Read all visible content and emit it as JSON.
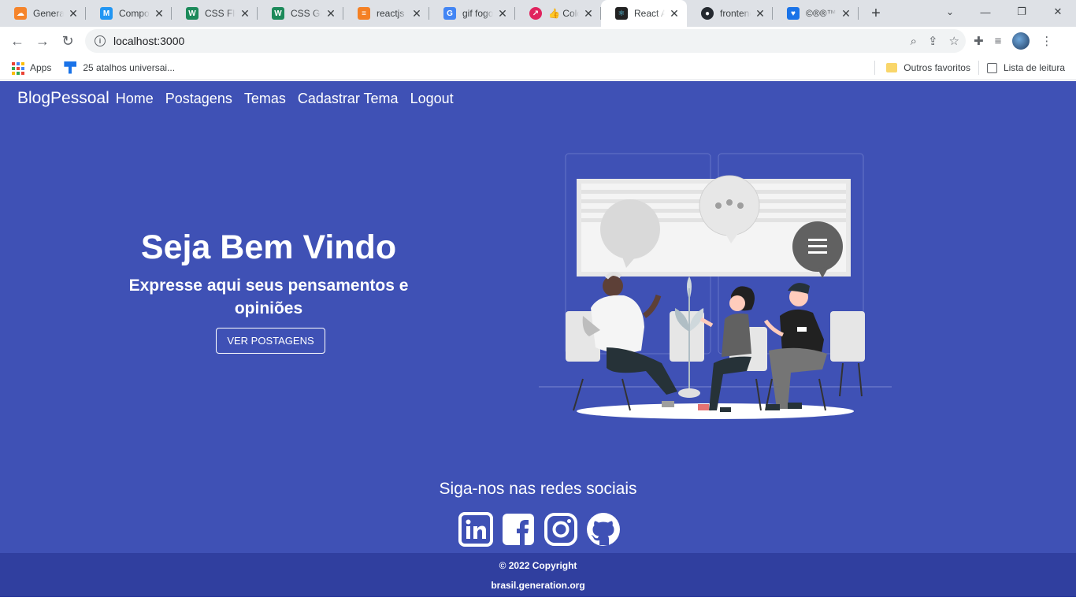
{
  "browser": {
    "tabs": [
      {
        "title": "Generati",
        "fav_color": "#f5842b",
        "fav_glyph": "☁"
      },
      {
        "title": "Compon",
        "fav_color": "#2196f3",
        "fav_glyph": "M"
      },
      {
        "title": "CSS Flex",
        "fav_color": "#1c8a5a",
        "fav_glyph": "W"
      },
      {
        "title": "CSS Grid",
        "fav_color": "#1c8a5a",
        "fav_glyph": "W"
      },
      {
        "title": "reactjs -",
        "fav_color": "#f48024",
        "fav_glyph": "≡"
      },
      {
        "title": "gif fogo",
        "fav_color": "#4285f4",
        "fav_glyph": "G"
      },
      {
        "title": "👍 Color",
        "fav_color": "#e0245e",
        "fav_glyph": "↗"
      },
      {
        "title": "React Ap",
        "fav_color": "#222222",
        "fav_glyph": "⚛",
        "active": true
      },
      {
        "title": "frontenc",
        "fav_color": "#24292f",
        "fav_glyph": "●"
      },
      {
        "title": "©®®™",
        "fav_color": "#1a73e8",
        "fav_glyph": "♥"
      }
    ],
    "new_tab_glyph": "+",
    "address": "localhost:3000",
    "bookmarks": {
      "apps_label": "Apps",
      "shortcut_label": "25 atalhos universai...",
      "other_favorites": "Outros favoritos",
      "reading_list": "Lista de leitura"
    }
  },
  "site": {
    "brand": "BlogPessoal",
    "nav": [
      "Home",
      "Postagens",
      "Temas",
      "Cadastrar Tema",
      "Logout"
    ],
    "hero_title": "Seja Bem Vindo",
    "hero_subtitle": "Expresse aqui seus pensamentos e opiniões",
    "hero_button": "VER POSTAGENS",
    "social_title": "Siga-nos nas redes sociais",
    "social_icons": [
      "linkedin-icon",
      "facebook-icon",
      "instagram-icon",
      "github-icon"
    ],
    "copyright": "© 2022 Copyright",
    "footer_link": "brasil.generation.org"
  },
  "colors": {
    "page_bg": "#3f51b5",
    "footer_bg": "#303f9f"
  }
}
